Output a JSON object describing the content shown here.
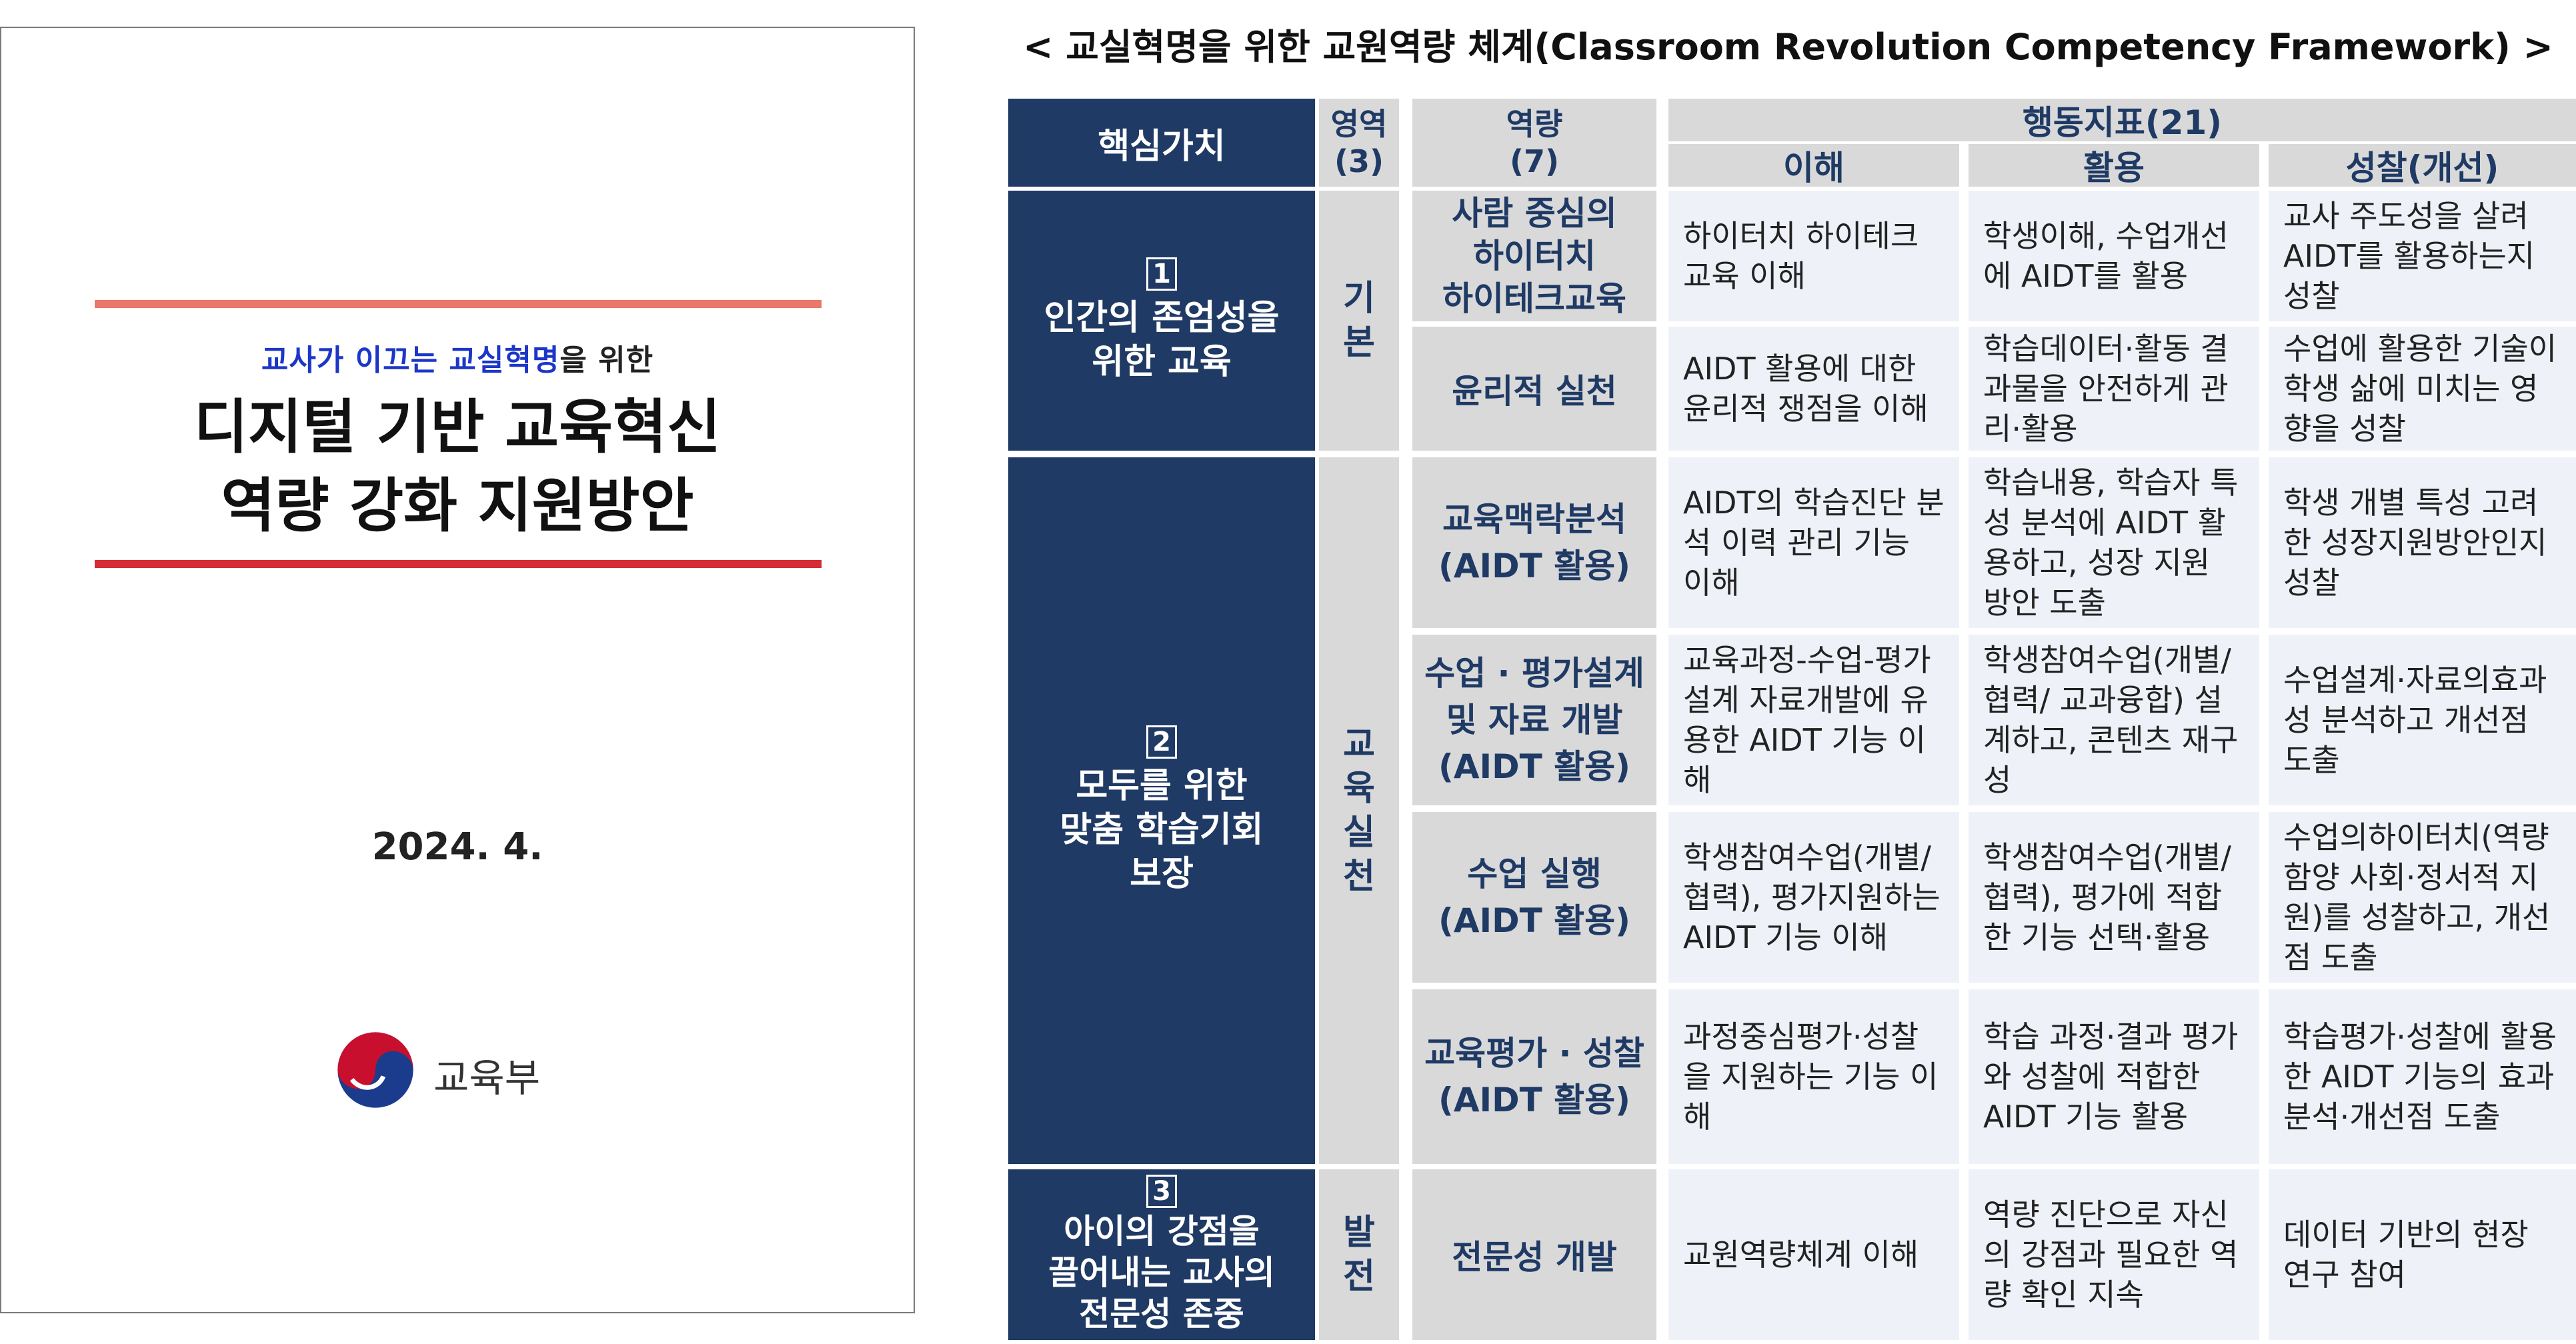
{
  "cover": {
    "subtitle_highlight_1": "교사가 이끄는",
    "subtitle_highlight_2": "교실혁명",
    "subtitle_rest": "을 위한",
    "title_line1": "디지털 기반 교육혁신",
    "title_line2": "역량 강화 지원방안",
    "date": "2024. 4.",
    "ministry": "교육부",
    "colors": {
      "highlight": "#1c36c8",
      "top_rule": "#e8786a",
      "bottom_rule": "#d42b34"
    }
  },
  "framework": {
    "title": "< 교실혁명을 위한 교원역량 체계(Classroom Revolution Competency Framework) >",
    "headers": {
      "core_value": "핵심가치",
      "domain": "영역\n(3)",
      "competency": "역량\n(7)",
      "indicators": "행동지표(21)",
      "understand": "이해",
      "apply": "활용",
      "reflect": "성찰(개선)"
    },
    "core_values": [
      {
        "num": "1",
        "text": "인간의 존엄성을\n위한 교육"
      },
      {
        "num": "2",
        "text": "모두를 위한\n맞춤 학습기회\n보장"
      },
      {
        "num": "3",
        "text": "아이의 강점을\n끌어내는 교사의\n전문성 존중"
      }
    ],
    "domains": [
      "기\n본",
      "교\n육\n실\n천",
      "발\n전"
    ],
    "rows": [
      {
        "competency": "사람 중심의\n하이터치\n하이테크교육",
        "understand": "하이터치 하이테크 교육 이해",
        "apply": "학생이해, 수업개선에 AIDT를 활용",
        "reflect": "교사 주도성을 살려 AIDT를 활용하는지 성찰"
      },
      {
        "competency": "윤리적 실천",
        "understand": "AIDT 활용에 대한 윤리적 쟁점을 이해",
        "apply": "학습데이터·활동 결과물을 안전하게 관리·활용",
        "reflect": "수업에 활용한 기술이 학생 삶에 미치는 영향을 성찰"
      },
      {
        "competency": "교육맥락분석\n(AIDT 활용)",
        "understand": "AIDT의 학습진단 분석 이력 관리 기능 이해",
        "apply": "학습내용, 학습자 특성 분석에 AIDT 활용하고, 성장 지원 방안 도출",
        "reflect": "학생 개별 특성 고려한 성장지원방안인지 성찰"
      },
      {
        "competency": "수업 · 평가설계\n및 자료 개발\n(AIDT 활용)",
        "understand": "교육과정-수업-평가설계 자료개발에 유용한 AIDT 기능 이해",
        "apply": "학생참여수업(개별/ 협력/ 교과융합) 설계하고, 콘텐츠 재구성",
        "reflect": "수업설계·자료의효과성 분석하고 개선점 도출"
      },
      {
        "competency": "수업 실행\n(AIDT 활용)",
        "understand": "학생참여수업(개별/ 협력), 평가지원하는 AIDT 기능 이해",
        "apply": "학생참여수업(개별/ 협력), 평가에 적합한 기능 선택·활용",
        "reflect": "수업의하이터치(역량함양 사회·정서적 지원)를 성찰하고, 개선점 도출"
      },
      {
        "competency": "교육평가 · 성찰\n(AIDT 활용)",
        "understand": "과정중심평가·성찰을 지원하는 기능 이해",
        "apply": "학습 과정·결과 평가와 성찰에 적합한 AIDT 기능 활용",
        "reflect": "학습평가·성찰에 활용한 AIDT 기능의 효과분석·개선점 도출"
      },
      {
        "competency": "전문성 개발",
        "understand": "교원역량체계 이해",
        "apply": "역량 진단으로 자신의 강점과 필요한 역량 확인 지속",
        "reflect": "데이터 기반의 현장 연구 참여"
      }
    ],
    "colors": {
      "navy": "#1f3a64",
      "gray": "#d9d9d9",
      "cell_bg": "#eef2f8"
    }
  }
}
